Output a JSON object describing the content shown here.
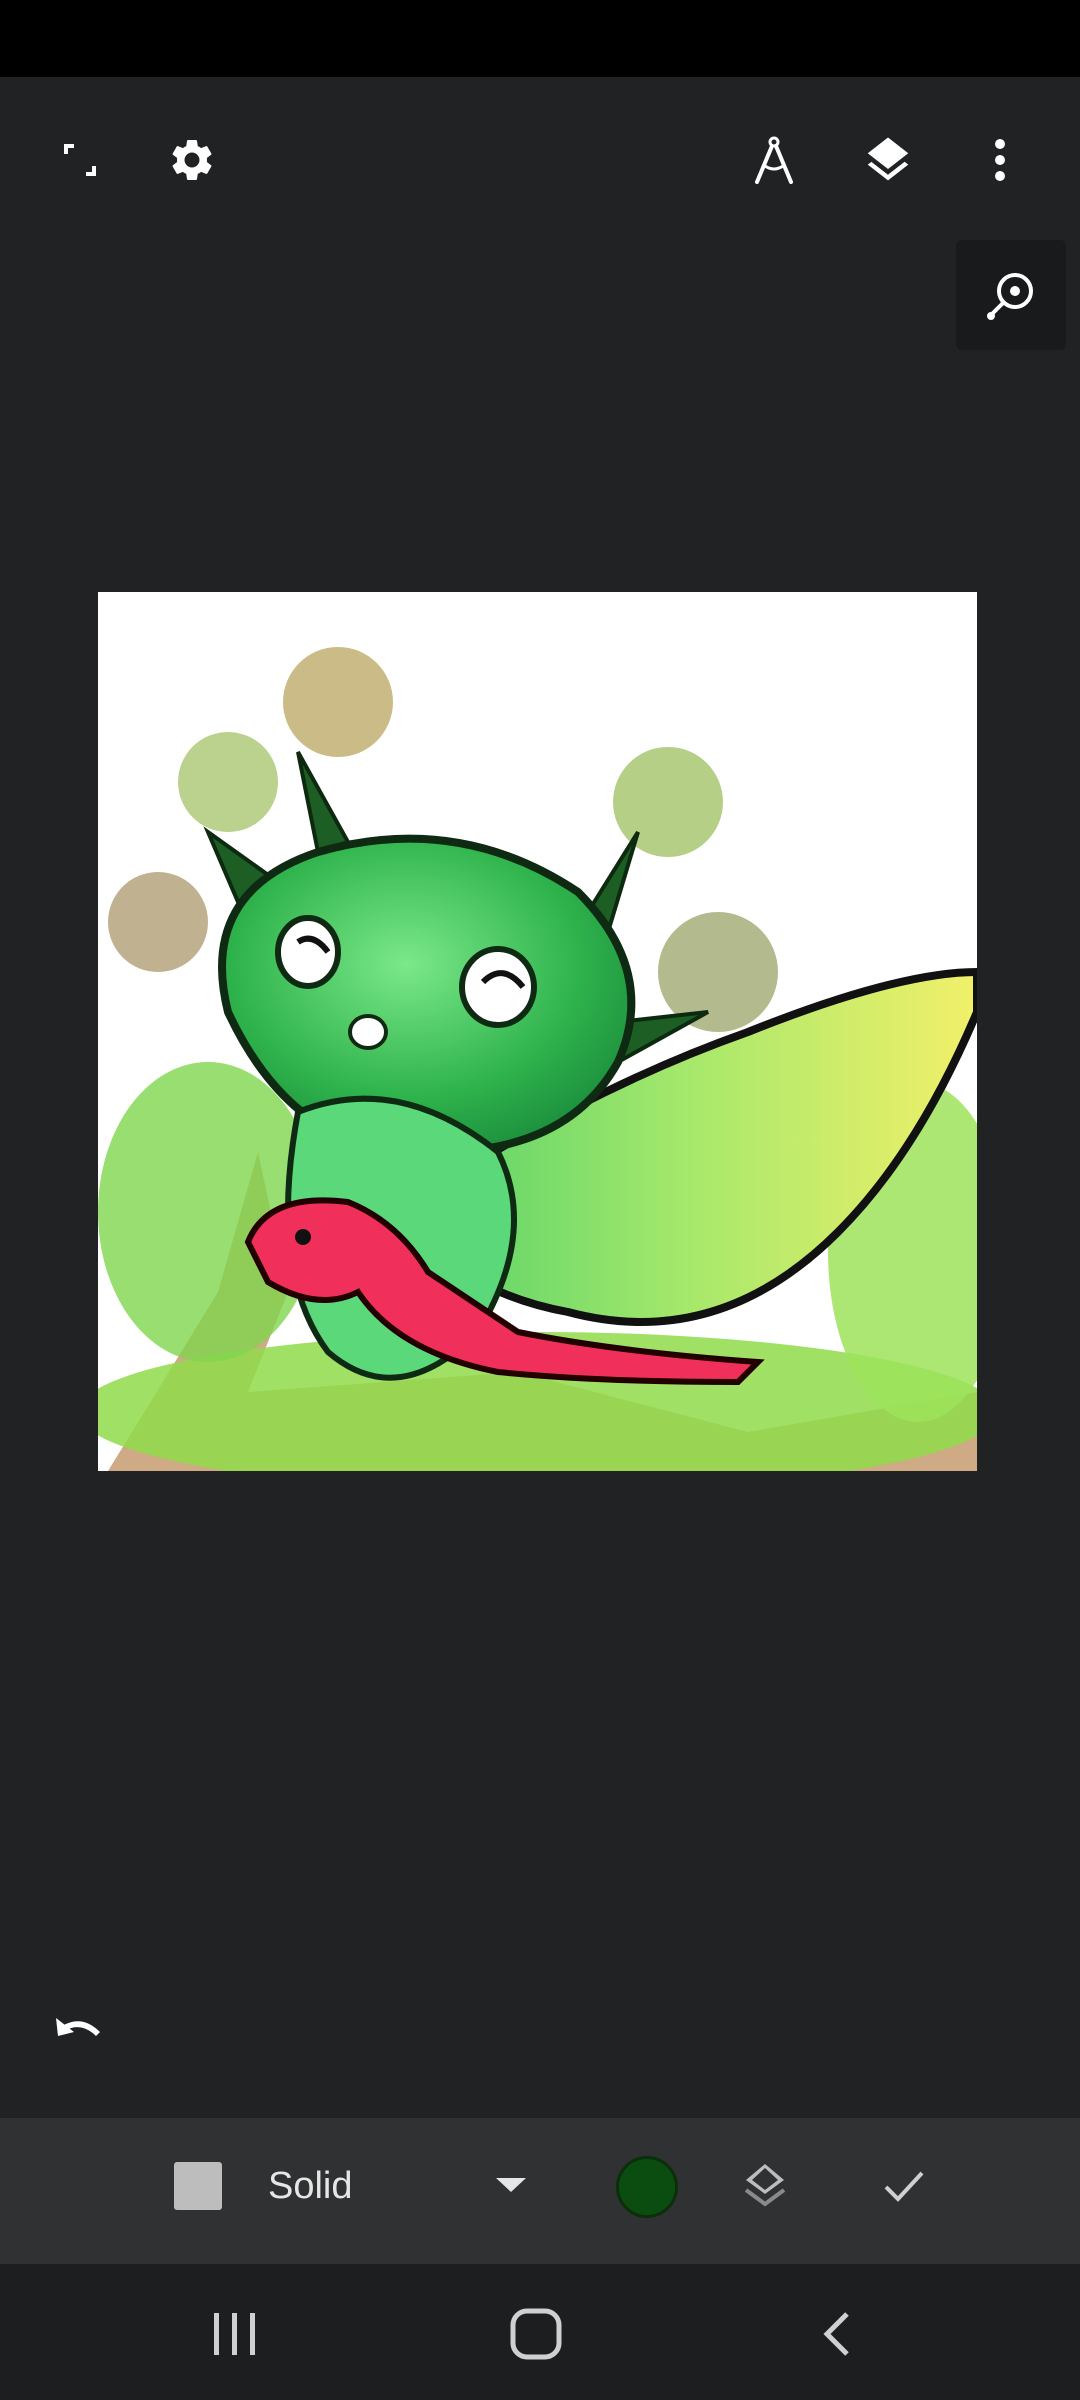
{
  "top_toolbar": {
    "fullscreen_icon": "fullscreen-icon",
    "settings_icon": "gear-icon",
    "ruler_icon": "compass-ruler-icon",
    "layers_icon": "layers-icon",
    "menu_icon": "more-vert-icon"
  },
  "zoom_panel": {
    "icon": "zoom-reset-icon"
  },
  "undo": {
    "icon": "undo-icon"
  },
  "fill_toolbar": {
    "mode_label": "Solid",
    "dropdown_icon": "chevron-down-icon",
    "current_color": "#0b4d10",
    "layer_fill_icon": "layer-fill-icon",
    "confirm_icon": "check-icon"
  },
  "colors": {
    "background": "#212224",
    "toolbar": "#2f3133",
    "icon": "#ffffff"
  }
}
